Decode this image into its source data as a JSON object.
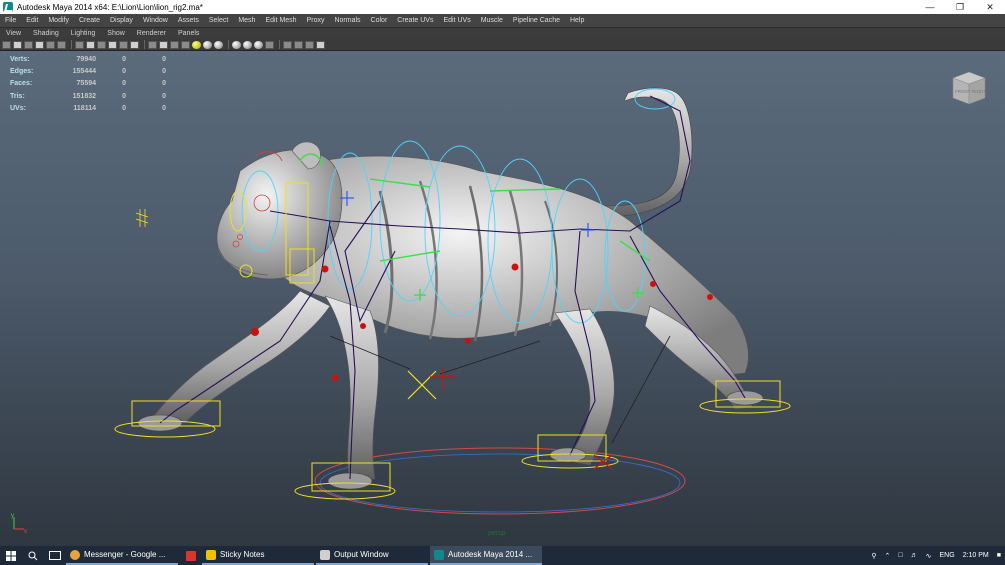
{
  "window": {
    "title": "Autodesk Maya 2014 x64: E:\\Lion\\Lion\\lion_rig2.ma*",
    "minimize": "—",
    "restore": "❐",
    "close": "✕"
  },
  "menubar": {
    "items": [
      "File",
      "Edit",
      "Modify",
      "Create",
      "Display",
      "Window",
      "Assets",
      "Select",
      "Mesh",
      "Edit Mesh",
      "Proxy",
      "Normals",
      "Color",
      "Create UVs",
      "Edit UVs",
      "Muscle",
      "Pipeline Cache",
      "Help"
    ]
  },
  "panel_menu": {
    "items": [
      "View",
      "Shading",
      "Lighting",
      "Show",
      "Renderer",
      "Panels"
    ]
  },
  "hud": {
    "rows": [
      {
        "label": "Verts:",
        "value": "79940",
        "z1": "0",
        "z2": "0"
      },
      {
        "label": "Edges:",
        "value": "155444",
        "z1": "0",
        "z2": "0"
      },
      {
        "label": "Faces:",
        "value": "75594",
        "z1": "0",
        "z2": "0"
      },
      {
        "label": "Tris:",
        "value": "151832",
        "z1": "0",
        "z2": "0"
      },
      {
        "label": "UVs:",
        "value": "118114",
        "z1": "0",
        "z2": "0"
      }
    ]
  },
  "viewcube": {
    "front": "FRONT",
    "right": "RIGHT"
  },
  "camera_label": "persp",
  "axis": {
    "y": "y",
    "x": "x"
  },
  "taskbar": {
    "tasks": [
      {
        "label": "Messenger - Google ...",
        "color": "#e8a33d"
      },
      {
        "label": "Sticky Notes",
        "color": "#f2c200"
      },
      {
        "label": "Output Window",
        "color": "#d0d0d0"
      },
      {
        "label": "Autodesk Maya 2014 ...",
        "color": "#0e8a8e"
      }
    ],
    "lang": "ENG",
    "time": "2:10 PM"
  },
  "colors": {
    "viewport_top": "#5b6b7c",
    "viewport_bottom": "#2f3740",
    "nurbs_curve": "#4fd3ff",
    "control_yellow": "#f0e020",
    "joint_red": "#cc1010",
    "bone_purple": "#2a1055"
  }
}
